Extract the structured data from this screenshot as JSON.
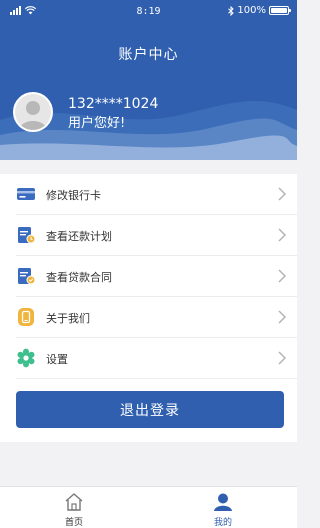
{
  "status_bar": {
    "time": "8:19",
    "battery": "100%"
  },
  "header": {
    "title": "账户中心"
  },
  "user": {
    "phone": "132****1024",
    "greeting": "用户您好!"
  },
  "menu": [
    {
      "label": "修改银行卡",
      "icon": "bank-card-icon"
    },
    {
      "label": "查看还款计划",
      "icon": "repayment-plan-icon"
    },
    {
      "label": "查看贷款合同",
      "icon": "loan-contract-icon"
    },
    {
      "label": "关于我们",
      "icon": "phone-icon"
    },
    {
      "label": "设置",
      "icon": "settings-gear-icon"
    }
  ],
  "logout_label": "退出登录",
  "tabs": [
    {
      "label": "首页",
      "icon": "home-icon",
      "active": false
    },
    {
      "label": "我的",
      "icon": "profile-icon",
      "active": true
    }
  ],
  "colors": {
    "primary": "#2f5fae",
    "icon_orange": "#f1b43c",
    "icon_green": "#3fbf8e"
  }
}
